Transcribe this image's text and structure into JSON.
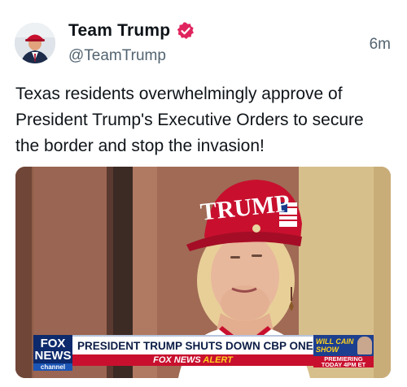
{
  "post": {
    "display_name": "Team Trump",
    "handle": "@TeamTrump",
    "timestamp": "6m",
    "text": "Texas residents overwhelmingly approve of President Trump's Executive Orders to secure the border and stop the invasion!",
    "verified_icon": "verified-badge-icon",
    "verified_color": "#e0245e"
  },
  "media": {
    "hat_text": "TRUMP",
    "network_logo_line1": "FOX",
    "network_logo_line2": "NEWS",
    "network_logo_line3": "channel",
    "headline": "PRESIDENT TRUMP SHUTS DOWN CBP ONE APP",
    "alert_prefix": "FOX NEWS",
    "alert_word": "ALERT",
    "promo_show": "WILL CAIN SHOW",
    "promo_when_line1": "PREMIERING",
    "promo_when_line2": "TODAY 4PM ET"
  }
}
